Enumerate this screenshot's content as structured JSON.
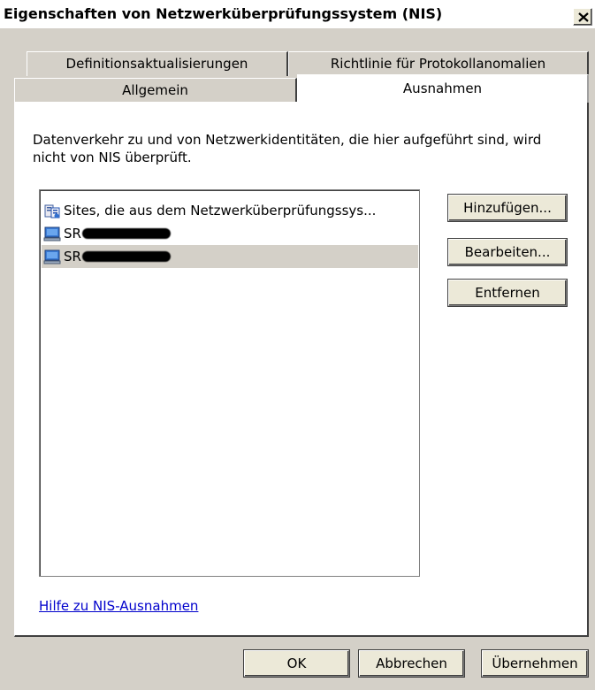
{
  "window": {
    "title": "Eigenschaften von Netzwerküberprüfungssystem (NIS)"
  },
  "tabs": {
    "row_back": [
      "Definitionsaktualisierungen",
      "Richtlinie für Protokollanomalien"
    ],
    "row_front": [
      "Allgemein",
      "Ausnahmen"
    ],
    "active": "Ausnahmen"
  },
  "panel": {
    "description": "Datenverkehr zu und von Netzwerkidentitäten, die hier aufgeführt sind, wird nicht von NIS überprüft.",
    "list_items": [
      {
        "label": "Sites, die aus dem Netzwerküberprüfungssys...",
        "icon": "sites-icon",
        "selected": false
      },
      {
        "label": "SR",
        "icon": "computer-icon",
        "selected": false,
        "redacted": true
      },
      {
        "label": "SR",
        "icon": "computer-icon",
        "selected": true,
        "redacted": true
      }
    ],
    "buttons": {
      "add": "Hinzufügen...",
      "edit": "Bearbeiten...",
      "remove": "Entfernen"
    },
    "help_link": "Hilfe zu NIS-Ausnahmen"
  },
  "footer": {
    "ok": "OK",
    "cancel": "Abbrechen",
    "apply": "Übernehmen"
  }
}
